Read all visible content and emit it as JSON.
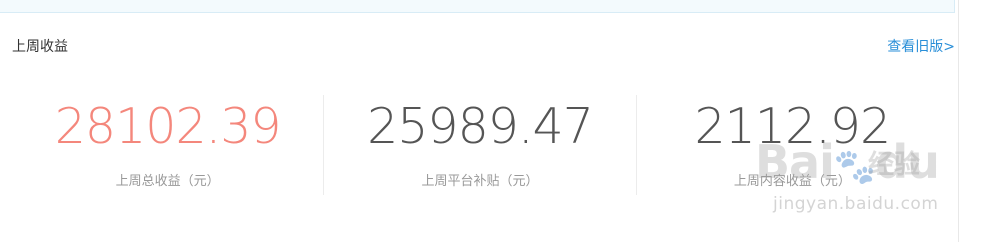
{
  "section": {
    "title": "上周收益",
    "old_version_link": "查看旧版>"
  },
  "stats": [
    {
      "value": "28102.39",
      "label": "上周总收益（元）"
    },
    {
      "value": "25989.47",
      "label": "上周平台补贴（元）"
    },
    {
      "value": "2112.92",
      "label": "上周内容收益（元）"
    }
  ],
  "watermark": {
    "logo": "Bai 经验",
    "url": "jingyan.baidu.com"
  },
  "colors": {
    "highlight": "#f4877c",
    "link": "#2a8fd8"
  }
}
